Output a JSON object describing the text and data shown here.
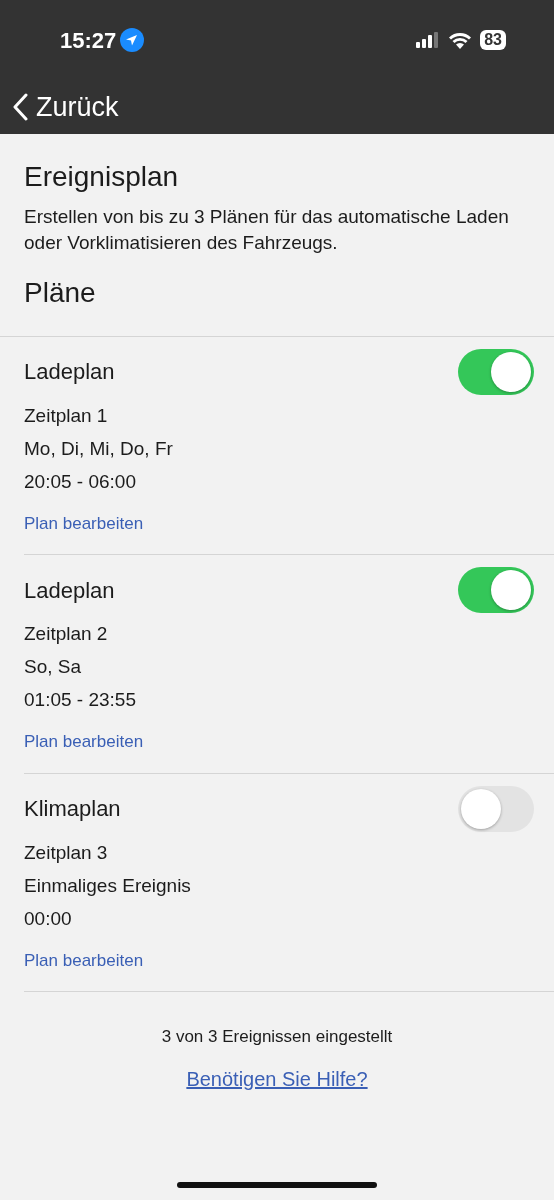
{
  "status_bar": {
    "time": "15:27",
    "battery": "83"
  },
  "nav": {
    "back": "Zurück"
  },
  "title": "Ereignisplan",
  "description": "Erstellen von bis zu 3 Plänen für das automatische Laden oder Vorklimatisieren des Fahrzeugs.",
  "section_title": "Pläne",
  "plans": [
    {
      "type": "Ladeplan",
      "schedule": "Zeitplan 1",
      "days": "Mo, Di, Mi, Do, Fr",
      "time": "20:05 - 06:00",
      "edit": "Plan bearbeiten",
      "on": true
    },
    {
      "type": "Ladeplan",
      "schedule": "Zeitplan 2",
      "days": "So, Sa",
      "time": "01:05 - 23:55",
      "edit": "Plan bearbeiten",
      "on": true
    },
    {
      "type": "Klimaplan",
      "schedule": "Zeitplan 3",
      "days": "Einmaliges Ereignis",
      "time": "00:00",
      "edit": "Plan bearbeiten",
      "on": false
    }
  ],
  "footer": {
    "summary": "3 von 3 Ereignissen eingestellt",
    "help": "Benötigen Sie Hilfe?"
  }
}
